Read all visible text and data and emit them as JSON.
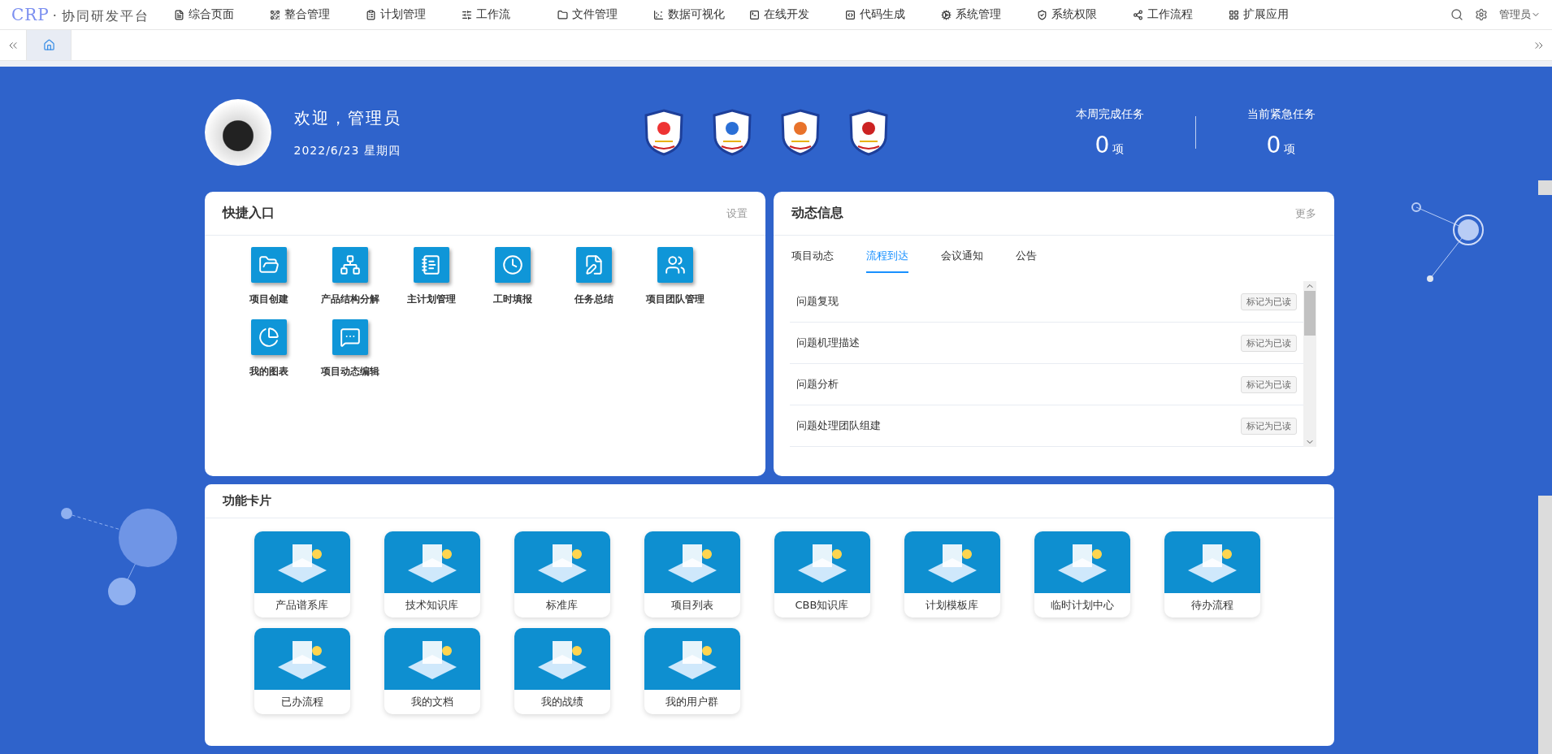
{
  "brand": {
    "logo": "CRP",
    "separator": "·",
    "name": "协同研发平台"
  },
  "nav": [
    {
      "label": "综合页面"
    },
    {
      "label": "整合管理"
    },
    {
      "label": "计划管理"
    },
    {
      "label": "工作流"
    },
    {
      "label": "文件管理"
    },
    {
      "label": "数据可视化"
    },
    {
      "label": "在线开发"
    },
    {
      "label": "代码生成"
    },
    {
      "label": "系统管理"
    },
    {
      "label": "系统权限"
    },
    {
      "label": "工作流程"
    },
    {
      "label": "扩展应用"
    }
  ],
  "user": {
    "name": "管理员"
  },
  "tabs": [
    {
      "selected": true
    }
  ],
  "welcome": {
    "greeting": "欢迎，管理员",
    "date": "2022/6/23",
    "weekday": "星期四"
  },
  "stats": [
    {
      "label": "本周完成任务",
      "value": "0",
      "unit": "项"
    },
    {
      "label": "当前紧急任务",
      "value": "0",
      "unit": "项"
    }
  ],
  "quick": {
    "title": "快捷入口",
    "action": "设置",
    "items": [
      {
        "label": "项目创建"
      },
      {
        "label": "产品结构分解"
      },
      {
        "label": "主计划管理"
      },
      {
        "label": "工时填报"
      },
      {
        "label": "任务总结"
      },
      {
        "label": "项目团队管理"
      },
      {
        "label": "我的图表"
      },
      {
        "label": "项目动态编辑"
      }
    ]
  },
  "news": {
    "title": "动态信息",
    "action": "更多",
    "tabs": [
      {
        "label": "项目动态",
        "selected": false
      },
      {
        "label": "流程到达",
        "selected": true
      },
      {
        "label": "会议通知",
        "selected": false
      },
      {
        "label": "公告",
        "selected": false
      }
    ],
    "items": [
      {
        "title": "问题复现",
        "action": "标记为已读"
      },
      {
        "title": "问题机理描述",
        "action": "标记为已读"
      },
      {
        "title": "问题分析",
        "action": "标记为已读"
      },
      {
        "title": "问题处理团队组建",
        "action": "标记为已读"
      }
    ]
  },
  "features": {
    "title": "功能卡片",
    "items": [
      {
        "label": "产品谱系库"
      },
      {
        "label": "技术知识库"
      },
      {
        "label": "标准库"
      },
      {
        "label": "项目列表"
      },
      {
        "label": "CBB知识库"
      },
      {
        "label": "计划模板库"
      },
      {
        "label": "临时计划中心"
      },
      {
        "label": "待办流程"
      },
      {
        "label": "已办流程"
      },
      {
        "label": "我的文档"
      },
      {
        "label": "我的战绩"
      },
      {
        "label": "我的用户群"
      }
    ]
  }
}
